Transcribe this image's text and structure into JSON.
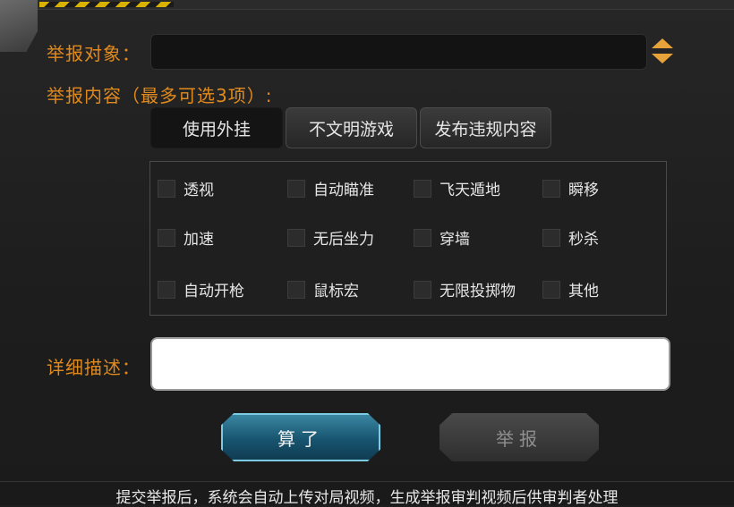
{
  "colors": {
    "accent": "#e08a1e",
    "button_blue": "#17546f"
  },
  "form": {
    "target_label": "举报对象：",
    "content_label": "举报内容（最多可选3项）:",
    "desc_label": "详细描述：",
    "target_value": "",
    "desc_value": ""
  },
  "tabs": [
    {
      "label": "使用外挂",
      "selected": true
    },
    {
      "label": "不文明游戏",
      "selected": false
    },
    {
      "label": "发布违规内容",
      "selected": false
    }
  ],
  "options": [
    {
      "label": "透视",
      "checked": false
    },
    {
      "label": "自动瞄准",
      "checked": false
    },
    {
      "label": "飞天遁地",
      "checked": false
    },
    {
      "label": "瞬移",
      "checked": false
    },
    {
      "label": "加速",
      "checked": false
    },
    {
      "label": "无后坐力",
      "checked": false
    },
    {
      "label": "穿墙",
      "checked": false
    },
    {
      "label": "秒杀",
      "checked": false
    },
    {
      "label": "自动开枪",
      "checked": false
    },
    {
      "label": "鼠标宏",
      "checked": false
    },
    {
      "label": "无限投掷物",
      "checked": false
    },
    {
      "label": "其他",
      "checked": false
    }
  ],
  "buttons": {
    "cancel": "算了",
    "report": "举报"
  },
  "footer": "提交举报后，系统会自动上传对局视频，生成举报审判视频后供审判者处理",
  "icons": {
    "sort": "sort-up-down-icon"
  }
}
